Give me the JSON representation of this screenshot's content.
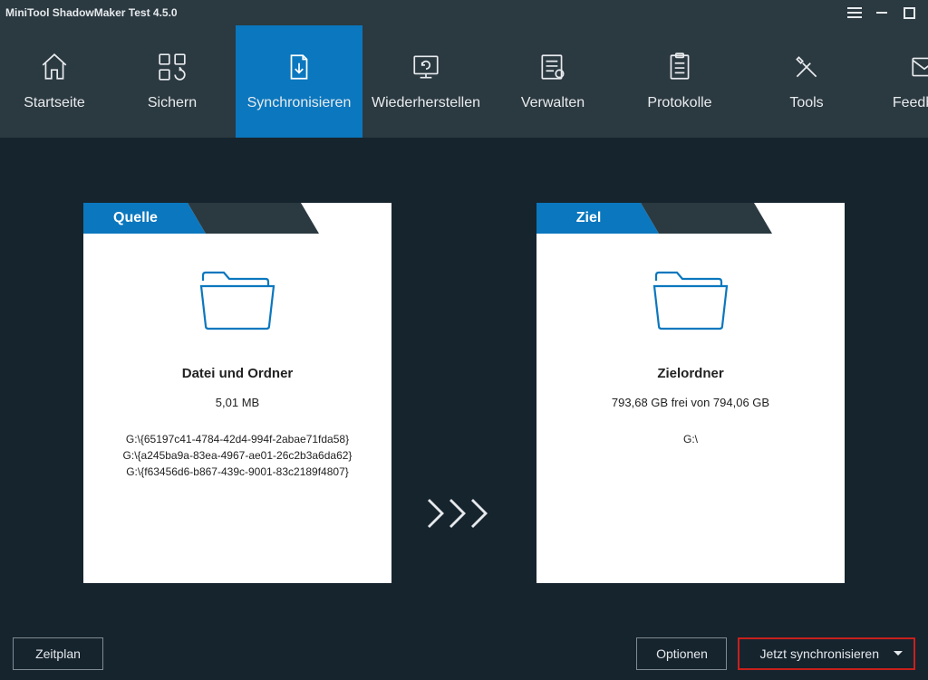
{
  "titlebar": {
    "title": "MiniTool ShadowMaker Test 4.5.0"
  },
  "nav": {
    "items": [
      {
        "label": "Startseite"
      },
      {
        "label": "Sichern"
      },
      {
        "label": "Synchronisieren"
      },
      {
        "label": "Wiederherstellen"
      },
      {
        "label": "Verwalten"
      },
      {
        "label": "Protokolle"
      },
      {
        "label": "Tools"
      },
      {
        "label": "Feedback"
      }
    ],
    "active_index": 2
  },
  "source_panel": {
    "tab": "Quelle",
    "title": "Datei und Ordner",
    "subtitle": "5,01 MB",
    "lines": [
      "G:\\{65197c41-4784-42d4-994f-2abae71fda58}",
      "G:\\{a245ba9a-83ea-4967-ae01-26c2b3a6da62}",
      "G:\\{f63456d6-b867-439c-9001-83c2189f4807}"
    ]
  },
  "dest_panel": {
    "tab": "Ziel",
    "title": "Zielordner",
    "subtitle": "793,68 GB frei von 794,06 GB",
    "lines": [
      "G:\\"
    ]
  },
  "footer": {
    "schedule": "Zeitplan",
    "options": "Optionen",
    "sync_now": "Jetzt synchronisieren"
  }
}
